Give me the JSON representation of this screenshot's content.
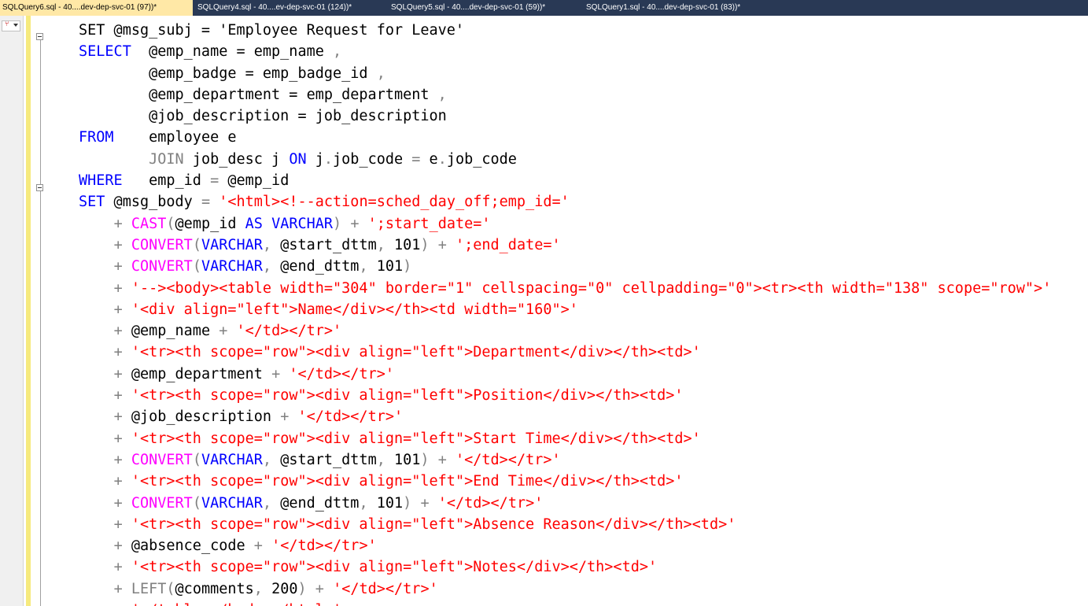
{
  "tabs": [
    {
      "label": "SQLQuery6.sql - 40....dev-dep-svc-01 (97))*",
      "active": true
    },
    {
      "label": "SQLQuery4.sql - 40....ev-dep-svc-01 (124))*",
      "active": false
    },
    {
      "label": "SQLQuery5.sql - 40....dev-dep-svc-01 (59))*",
      "active": false
    },
    {
      "label": "SQLQuery1.sql - 40....dev-dep-svc-01 (83))*",
      "active": false
    }
  ],
  "colors": {
    "keyword": "#0000ff",
    "function": "#ff00ff",
    "string": "#ff0000",
    "operator": "#808080",
    "tab_bar": "#293955",
    "active_tab": "#ffe8a6",
    "change_bar": "#f6ea7e"
  },
  "icons": {
    "navigation_dropdown": "navigation-dropdown-icon",
    "collapse": "collapse-minus-icon"
  },
  "editor": {
    "lines": [
      [
        {
          "t": "SET @msg_subj = 'Employee Request for Leave'",
          "c": "tx"
        }
      ],
      [
        {
          "t": "SELECT",
          "c": "kw"
        },
        {
          "t": "  @emp_name = emp_name ",
          "c": "tx"
        },
        {
          "t": ",",
          "c": "op"
        }
      ],
      [
        {
          "t": "        @emp_badge = emp_badge_id ",
          "c": "tx"
        },
        {
          "t": ",",
          "c": "op"
        }
      ],
      [
        {
          "t": "        @emp_department = emp_department ",
          "c": "tx"
        },
        {
          "t": ",",
          "c": "op"
        }
      ],
      [
        {
          "t": "        @job_description = job_description",
          "c": "tx"
        }
      ],
      [
        {
          "t": "FROM",
          "c": "kw"
        },
        {
          "t": "    employee e",
          "c": "tx"
        }
      ],
      [
        {
          "t": "        ",
          "c": "tx"
        },
        {
          "t": "JOIN",
          "c": "op"
        },
        {
          "t": " job_desc j ",
          "c": "tx"
        },
        {
          "t": "ON",
          "c": "kw"
        },
        {
          "t": " j",
          "c": "tx"
        },
        {
          "t": ".",
          "c": "op"
        },
        {
          "t": "job_code ",
          "c": "tx"
        },
        {
          "t": "=",
          "c": "op"
        },
        {
          "t": " e",
          "c": "tx"
        },
        {
          "t": ".",
          "c": "op"
        },
        {
          "t": "job_code",
          "c": "tx"
        }
      ],
      [
        {
          "t": "WHERE",
          "c": "kw"
        },
        {
          "t": "   emp_id ",
          "c": "tx"
        },
        {
          "t": "=",
          "c": "op"
        },
        {
          "t": " @emp_id",
          "c": "tx"
        }
      ],
      [
        {
          "t": "SET",
          "c": "kw"
        },
        {
          "t": " @msg_body ",
          "c": "tx"
        },
        {
          "t": "=",
          "c": "op"
        },
        {
          "t": " ",
          "c": "tx"
        },
        {
          "t": "'<html><!--action=sched_day_off;emp_id='",
          "c": "str"
        }
      ],
      [
        {
          "t": "    ",
          "c": "tx"
        },
        {
          "t": "+",
          "c": "op"
        },
        {
          "t": " ",
          "c": "tx"
        },
        {
          "t": "CAST",
          "c": "fn"
        },
        {
          "t": "(",
          "c": "op"
        },
        {
          "t": "@emp_id ",
          "c": "tx"
        },
        {
          "t": "AS",
          "c": "kw"
        },
        {
          "t": " ",
          "c": "tx"
        },
        {
          "t": "VARCHAR",
          "c": "kw"
        },
        {
          "t": ")",
          "c": "op"
        },
        {
          "t": " ",
          "c": "tx"
        },
        {
          "t": "+",
          "c": "op"
        },
        {
          "t": " ",
          "c": "tx"
        },
        {
          "t": "';start_date='",
          "c": "str"
        }
      ],
      [
        {
          "t": "    ",
          "c": "tx"
        },
        {
          "t": "+",
          "c": "op"
        },
        {
          "t": " ",
          "c": "tx"
        },
        {
          "t": "CONVERT",
          "c": "fn"
        },
        {
          "t": "(",
          "c": "op"
        },
        {
          "t": "VARCHAR",
          "c": "kw"
        },
        {
          "t": ",",
          "c": "op"
        },
        {
          "t": " @start_dttm",
          "c": "tx"
        },
        {
          "t": ",",
          "c": "op"
        },
        {
          "t": " 101",
          "c": "tx"
        },
        {
          "t": ")",
          "c": "op"
        },
        {
          "t": " ",
          "c": "tx"
        },
        {
          "t": "+",
          "c": "op"
        },
        {
          "t": " ",
          "c": "tx"
        },
        {
          "t": "';end_date='",
          "c": "str"
        }
      ],
      [
        {
          "t": "    ",
          "c": "tx"
        },
        {
          "t": "+",
          "c": "op"
        },
        {
          "t": " ",
          "c": "tx"
        },
        {
          "t": "CONVERT",
          "c": "fn"
        },
        {
          "t": "(",
          "c": "op"
        },
        {
          "t": "VARCHAR",
          "c": "kw"
        },
        {
          "t": ",",
          "c": "op"
        },
        {
          "t": " @end_dttm",
          "c": "tx"
        },
        {
          "t": ",",
          "c": "op"
        },
        {
          "t": " 101",
          "c": "tx"
        },
        {
          "t": ")",
          "c": "op"
        }
      ],
      [
        {
          "t": "    ",
          "c": "tx"
        },
        {
          "t": "+",
          "c": "op"
        },
        {
          "t": " ",
          "c": "tx"
        },
        {
          "t": "'--><body><table width=\"304\" border=\"1\" cellspacing=\"0\" cellpadding=\"0\"><tr><th width=\"138\" scope=\"row\">'",
          "c": "str"
        }
      ],
      [
        {
          "t": "    ",
          "c": "tx"
        },
        {
          "t": "+",
          "c": "op"
        },
        {
          "t": " ",
          "c": "tx"
        },
        {
          "t": "'<div align=\"left\">Name</div></th><td width=\"160\">'",
          "c": "str"
        }
      ],
      [
        {
          "t": "    ",
          "c": "tx"
        },
        {
          "t": "+",
          "c": "op"
        },
        {
          "t": " @emp_name ",
          "c": "tx"
        },
        {
          "t": "+",
          "c": "op"
        },
        {
          "t": " ",
          "c": "tx"
        },
        {
          "t": "'</td></tr>'",
          "c": "str"
        }
      ],
      [
        {
          "t": "    ",
          "c": "tx"
        },
        {
          "t": "+",
          "c": "op"
        },
        {
          "t": " ",
          "c": "tx"
        },
        {
          "t": "'<tr><th scope=\"row\"><div align=\"left\">Department</div></th><td>'",
          "c": "str"
        }
      ],
      [
        {
          "t": "    ",
          "c": "tx"
        },
        {
          "t": "+",
          "c": "op"
        },
        {
          "t": " @emp_department ",
          "c": "tx"
        },
        {
          "t": "+",
          "c": "op"
        },
        {
          "t": " ",
          "c": "tx"
        },
        {
          "t": "'</td></tr>'",
          "c": "str"
        }
      ],
      [
        {
          "t": "    ",
          "c": "tx"
        },
        {
          "t": "+",
          "c": "op"
        },
        {
          "t": " ",
          "c": "tx"
        },
        {
          "t": "'<tr><th scope=\"row\"><div align=\"left\">Position</div></th><td>'",
          "c": "str"
        }
      ],
      [
        {
          "t": "    ",
          "c": "tx"
        },
        {
          "t": "+",
          "c": "op"
        },
        {
          "t": " @job_description ",
          "c": "tx"
        },
        {
          "t": "+",
          "c": "op"
        },
        {
          "t": " ",
          "c": "tx"
        },
        {
          "t": "'</td></tr>'",
          "c": "str"
        }
      ],
      [
        {
          "t": "    ",
          "c": "tx"
        },
        {
          "t": "+",
          "c": "op"
        },
        {
          "t": " ",
          "c": "tx"
        },
        {
          "t": "'<tr><th scope=\"row\"><div align=\"left\">Start Time</div></th><td>'",
          "c": "str"
        }
      ],
      [
        {
          "t": "    ",
          "c": "tx"
        },
        {
          "t": "+",
          "c": "op"
        },
        {
          "t": " ",
          "c": "tx"
        },
        {
          "t": "CONVERT",
          "c": "fn"
        },
        {
          "t": "(",
          "c": "op"
        },
        {
          "t": "VARCHAR",
          "c": "kw"
        },
        {
          "t": ",",
          "c": "op"
        },
        {
          "t": " @start_dttm",
          "c": "tx"
        },
        {
          "t": ",",
          "c": "op"
        },
        {
          "t": " 101",
          "c": "tx"
        },
        {
          "t": ")",
          "c": "op"
        },
        {
          "t": " ",
          "c": "tx"
        },
        {
          "t": "+",
          "c": "op"
        },
        {
          "t": " ",
          "c": "tx"
        },
        {
          "t": "'</td></tr>'",
          "c": "str"
        }
      ],
      [
        {
          "t": "    ",
          "c": "tx"
        },
        {
          "t": "+",
          "c": "op"
        },
        {
          "t": " ",
          "c": "tx"
        },
        {
          "t": "'<tr><th scope=\"row\"><div align=\"left\">End Time</div></th><td>'",
          "c": "str"
        }
      ],
      [
        {
          "t": "    ",
          "c": "tx"
        },
        {
          "t": "+",
          "c": "op"
        },
        {
          "t": " ",
          "c": "tx"
        },
        {
          "t": "CONVERT",
          "c": "fn"
        },
        {
          "t": "(",
          "c": "op"
        },
        {
          "t": "VARCHAR",
          "c": "kw"
        },
        {
          "t": ",",
          "c": "op"
        },
        {
          "t": " @end_dttm",
          "c": "tx"
        },
        {
          "t": ",",
          "c": "op"
        },
        {
          "t": " 101",
          "c": "tx"
        },
        {
          "t": ")",
          "c": "op"
        },
        {
          "t": " ",
          "c": "tx"
        },
        {
          "t": "+",
          "c": "op"
        },
        {
          "t": " ",
          "c": "tx"
        },
        {
          "t": "'</td></tr>'",
          "c": "str"
        }
      ],
      [
        {
          "t": "    ",
          "c": "tx"
        },
        {
          "t": "+",
          "c": "op"
        },
        {
          "t": " ",
          "c": "tx"
        },
        {
          "t": "'<tr><th scope=\"row\"><div align=\"left\">Absence Reason</div></th><td>'",
          "c": "str"
        }
      ],
      [
        {
          "t": "    ",
          "c": "tx"
        },
        {
          "t": "+",
          "c": "op"
        },
        {
          "t": " @absence_code ",
          "c": "tx"
        },
        {
          "t": "+",
          "c": "op"
        },
        {
          "t": " ",
          "c": "tx"
        },
        {
          "t": "'</td></tr>'",
          "c": "str"
        }
      ],
      [
        {
          "t": "    ",
          "c": "tx"
        },
        {
          "t": "+",
          "c": "op"
        },
        {
          "t": " ",
          "c": "tx"
        },
        {
          "t": "'<tr><th scope=\"row\"><div align=\"left\">Notes</div></th><td>'",
          "c": "str"
        }
      ],
      [
        {
          "t": "    ",
          "c": "tx"
        },
        {
          "t": "+",
          "c": "op"
        },
        {
          "t": " ",
          "c": "tx"
        },
        {
          "t": "LEFT",
          "c": "op"
        },
        {
          "t": "(",
          "c": "op"
        },
        {
          "t": "@comments",
          "c": "tx"
        },
        {
          "t": ",",
          "c": "op"
        },
        {
          "t": " 200",
          "c": "tx"
        },
        {
          "t": ")",
          "c": "op"
        },
        {
          "t": " ",
          "c": "tx"
        },
        {
          "t": "+",
          "c": "op"
        },
        {
          "t": " ",
          "c": "tx"
        },
        {
          "t": "'</td></tr>'",
          "c": "str"
        }
      ],
      [
        {
          "t": "    ",
          "c": "tx"
        },
        {
          "t": "+",
          "c": "op"
        },
        {
          "t": " ",
          "c": "tx"
        },
        {
          "t": "'</table></body></html>'",
          "c": "str"
        }
      ]
    ]
  }
}
